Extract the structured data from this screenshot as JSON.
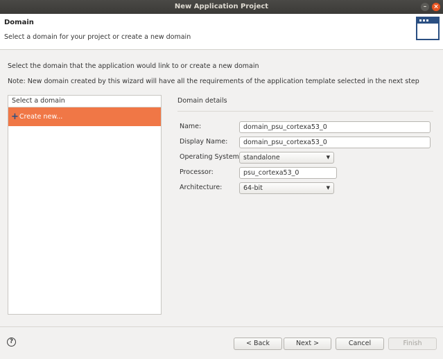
{
  "window": {
    "title": "New Application Project"
  },
  "header": {
    "title": "Domain",
    "subtitle": "Select a domain for your project or create a new domain"
  },
  "instructions": {
    "line1": "Select the domain that the application would link to or create a new domain",
    "line2": "Note: New domain created by this wizard will have all the requirements of the application template selected in the next step"
  },
  "domain_list": {
    "header": "Select a domain",
    "items": [
      {
        "label": "Create new...",
        "selected": true
      }
    ]
  },
  "details": {
    "title": "Domain details",
    "name_label": "Name:",
    "name_value": "domain_psu_cortexa53_0",
    "display_name_label": "Display Name:",
    "display_name_value": "domain_psu_cortexa53_0",
    "os_label": "Operating System:",
    "os_value": "standalone",
    "processor_label": "Processor:",
    "processor_value": "psu_cortexa53_0",
    "arch_label": "Architecture:",
    "arch_value": "64-bit"
  },
  "footer": {
    "help": "?",
    "back": "< Back",
    "next": "Next >",
    "cancel": "Cancel",
    "finish": "Finish"
  },
  "colors": {
    "selection": "#f07746",
    "accent": "#2a4f82"
  }
}
